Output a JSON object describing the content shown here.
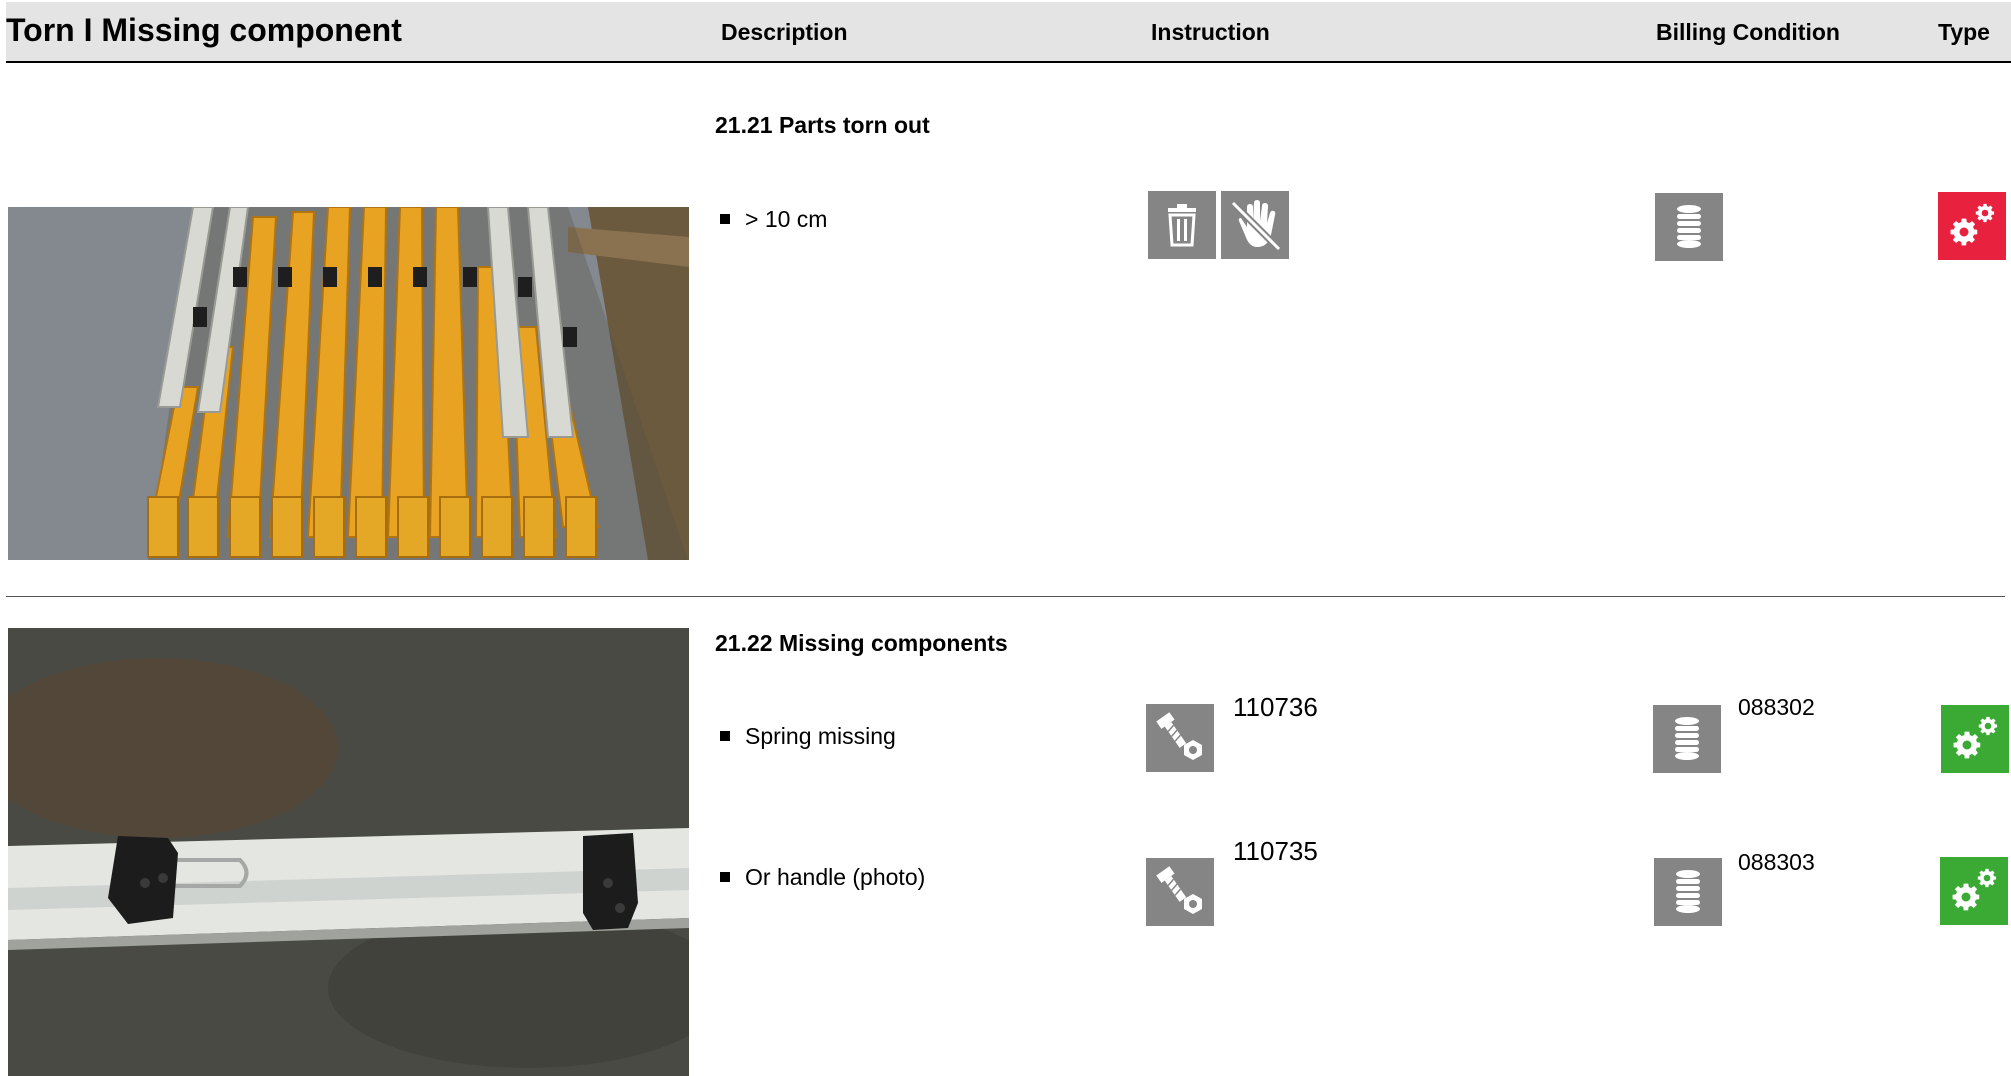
{
  "header": {
    "title": "Torn I Missing component",
    "columns": {
      "description": "Description",
      "instruction": "Instruction",
      "billing": "Billing Condition",
      "type": "Type"
    }
  },
  "sections": [
    {
      "title": "21.21 Parts torn out",
      "photo": "stacked yellow and white profile parts with numbered labels",
      "items": [
        {
          "description": "> 10 cm",
          "instruction_icons": [
            "trash-icon",
            "no-touch-hand-icon"
          ],
          "instruction_code": "",
          "billing_icon": "stack-icon",
          "billing_code": "",
          "type_icon": "gears-icon",
          "type_color": "#e8213f"
        }
      ]
    },
    {
      "title": "21.22 Missing components",
      "photo": "white rail with black clips and metal spring",
      "items": [
        {
          "description": "Spring missing",
          "instruction_icons": [
            "bolt-nut-icon"
          ],
          "instruction_code": "110736",
          "billing_icon": "stack-icon",
          "billing_code": "088302",
          "type_icon": "gears-icon",
          "type_color": "#3aaa35"
        },
        {
          "description": "Or handle (photo)",
          "instruction_icons": [
            "bolt-nut-icon"
          ],
          "instruction_code": "110735",
          "billing_icon": "stack-icon",
          "billing_code": "088303",
          "type_icon": "gears-icon",
          "type_color": "#3aaa35"
        }
      ]
    }
  ],
  "colors": {
    "header_bg": "#e4e4e4",
    "icon_gray": "#858585",
    "type_red": "#e8213f",
    "type_green": "#3aaa35"
  }
}
